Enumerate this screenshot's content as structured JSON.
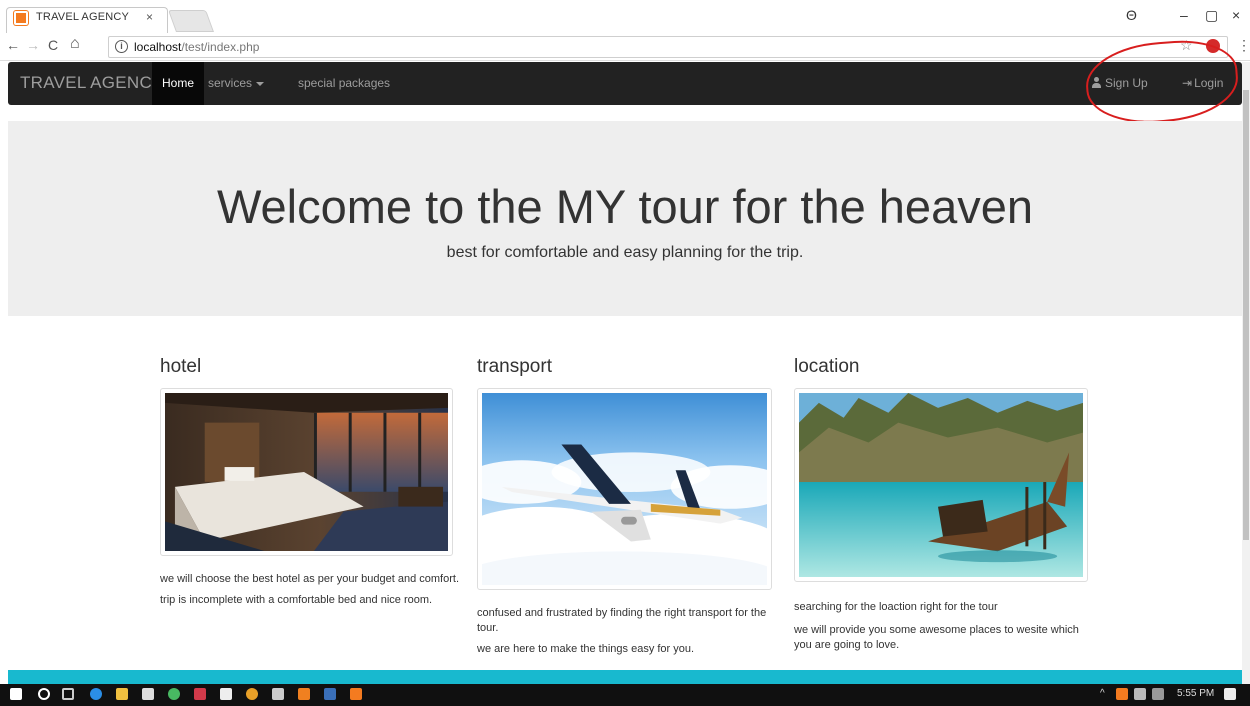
{
  "browser": {
    "tab_title": "TRAVEL AGENCY",
    "tab_close": "×",
    "url_host": "localhost",
    "url_path": "/test/index.php",
    "controls": {
      "account": "Θ",
      "minimize": "–",
      "restore": "▢",
      "close": "×"
    },
    "nav": {
      "back": "←",
      "forward": "→",
      "reload": "C",
      "home": "⌂",
      "info": "i",
      "star": "☆",
      "menu": "⋮"
    }
  },
  "navbar": {
    "brand": "TRAVEL AGENCY",
    "items": [
      {
        "label": "Home"
      },
      {
        "label": "services"
      },
      {
        "label": "special packages"
      }
    ],
    "signup": "Sign Up",
    "login": "Login",
    "login_icon": "⇥"
  },
  "jumbotron": {
    "title": "Welcome to the MY tour for the heaven",
    "subtitle": "best for comfortable and easy planning for the trip."
  },
  "columns": [
    {
      "title": "hotel",
      "paragraphs": [
        "we will choose the best hotel as per your budget and comfort.",
        "trip is incomplete with a comfortable bed and nice room."
      ]
    },
    {
      "title": "transport",
      "paragraphs": [
        "confused and frustrated by finding the right transport for the tour.",
        "we are here to make the things easy for you."
      ]
    },
    {
      "title": "location",
      "paragraphs": [
        "searching for the loaction right for the tour",
        "we will provide you some awesome places to wesite which you are going to love."
      ]
    }
  ],
  "taskbar": {
    "time": "5:55 PM",
    "tray": "^"
  },
  "colors": {
    "navbar": "#222222",
    "jumbotron": "#eeeeee",
    "footer": "#18b9cf",
    "annotation": "#d81e1e"
  }
}
